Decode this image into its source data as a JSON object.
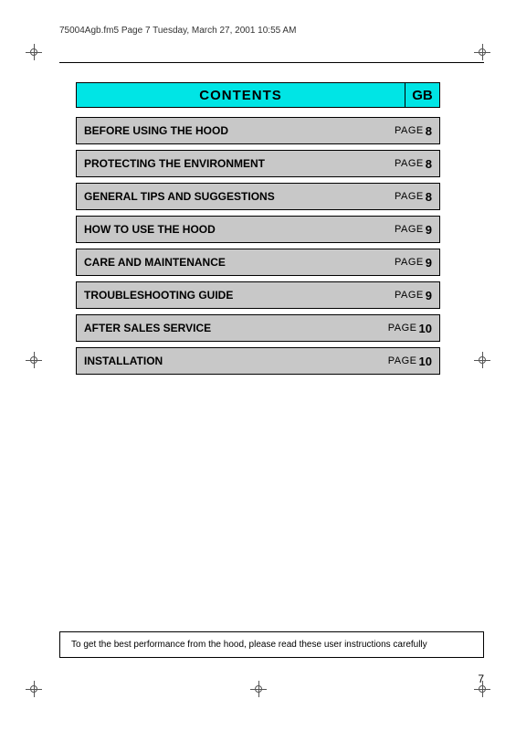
{
  "header": {
    "file_info": "75004Agb.fm5  Page 7  Tuesday, March 27, 2001  10:55 AM"
  },
  "contents": {
    "title": "CONTENTS",
    "gb_label": "GB"
  },
  "toc": {
    "rows": [
      {
        "label": "BEFORE USING THE HOOD",
        "page_word": "PAGE",
        "page_num": "8"
      },
      {
        "label": "PROTECTING THE ENVIRONMENT",
        "page_word": "PAGE",
        "page_num": "8"
      },
      {
        "label": "GENERAL TIPS AND SUGGESTIONS",
        "page_word": "PAGE",
        "page_num": "8"
      },
      {
        "label": "HOW TO USE THE HOOD",
        "page_word": "PAGE",
        "page_num": "9"
      },
      {
        "label": "CARE AND MAINTENANCE",
        "page_word": "PAGE",
        "page_num": "9"
      },
      {
        "label": "TROUBLESHOOTING GUIDE",
        "page_word": "PAGE",
        "page_num": "9"
      },
      {
        "label": "AFTER SALES SERVICE",
        "page_word": "PAGE",
        "page_num": "10"
      },
      {
        "label": "INSTALLATION",
        "page_word": "PAGE",
        "page_num": "10"
      }
    ]
  },
  "footer": {
    "note": "To get the best performance from the hood, please read these user instructions carefully",
    "page_number": "7"
  }
}
